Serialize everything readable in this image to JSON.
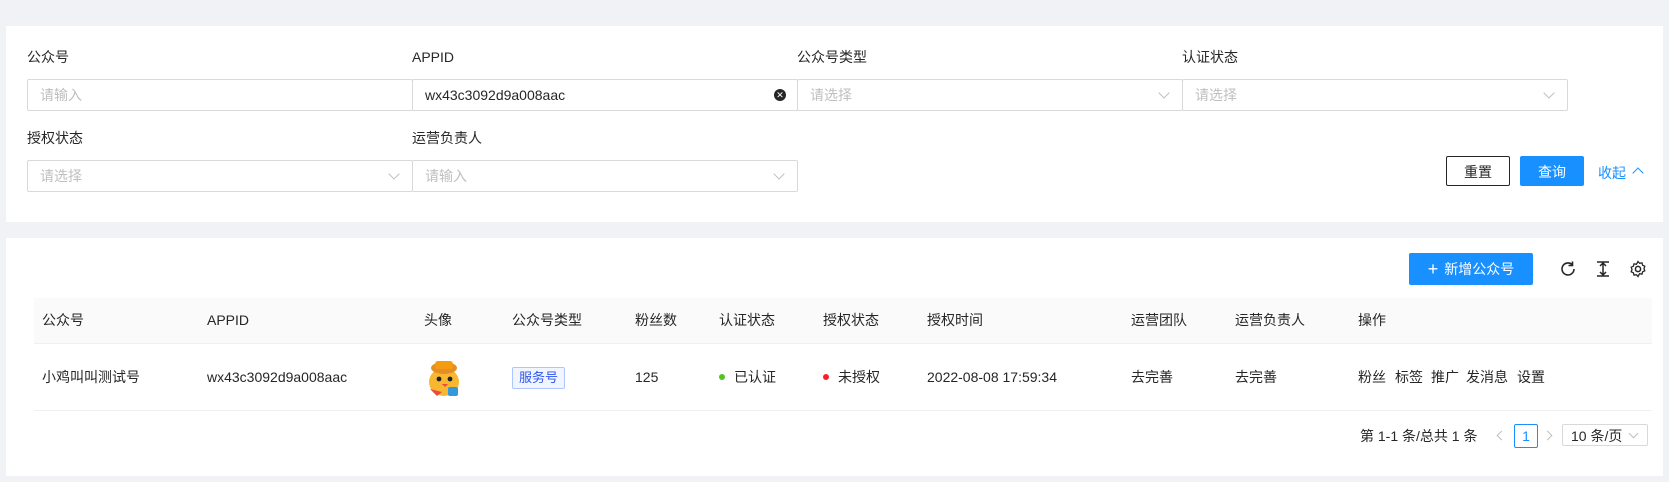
{
  "filters": {
    "account": {
      "label": "公众号",
      "placeholder": "请输入"
    },
    "appid": {
      "label": "APPID",
      "value": "wx43c3092d9a008aac"
    },
    "account_type": {
      "label": "公众号类型",
      "placeholder": "请选择"
    },
    "cert_status": {
      "label": "认证状态",
      "placeholder": "请选择"
    },
    "auth_status": {
      "label": "授权状态",
      "placeholder": "请选择"
    },
    "operator": {
      "label": "运营负责人",
      "placeholder": "请输入"
    },
    "reset_label": "重置",
    "query_label": "查询",
    "collapse_label": "收起"
  },
  "toolbar": {
    "add_label": "新增公众号",
    "icons": [
      "reload-icon",
      "column-height-icon",
      "setting-icon"
    ]
  },
  "table": {
    "columns": [
      "公众号",
      "APPID",
      "头像",
      "公众号类型",
      "粉丝数",
      "认证状态",
      "授权状态",
      "授权时间",
      "运营团队",
      "运营负责人",
      "操作"
    ],
    "rows": [
      {
        "name": "小鸡叫叫测试号",
        "appid": "wx43c3092d9a008aac",
        "avatar": "cartoon-chick-avatar",
        "type": "服务号",
        "fans": "125",
        "cert_status": "已认证",
        "cert_color": "#52c41a",
        "auth_status": "未授权",
        "auth_color": "#f5222d",
        "auth_time": "2022-08-08 17:59:34",
        "team": "去完善",
        "manager": "去完善",
        "actions": [
          "粉丝",
          "标签",
          "推广",
          "发消息",
          "设置"
        ]
      }
    ]
  },
  "pagination": {
    "summary": "第 1-1 条/总共 1 条",
    "current": "1",
    "page_size": "10 条/页"
  },
  "colors": {
    "primary": "#1890ff",
    "background": "#f0f2f5"
  }
}
